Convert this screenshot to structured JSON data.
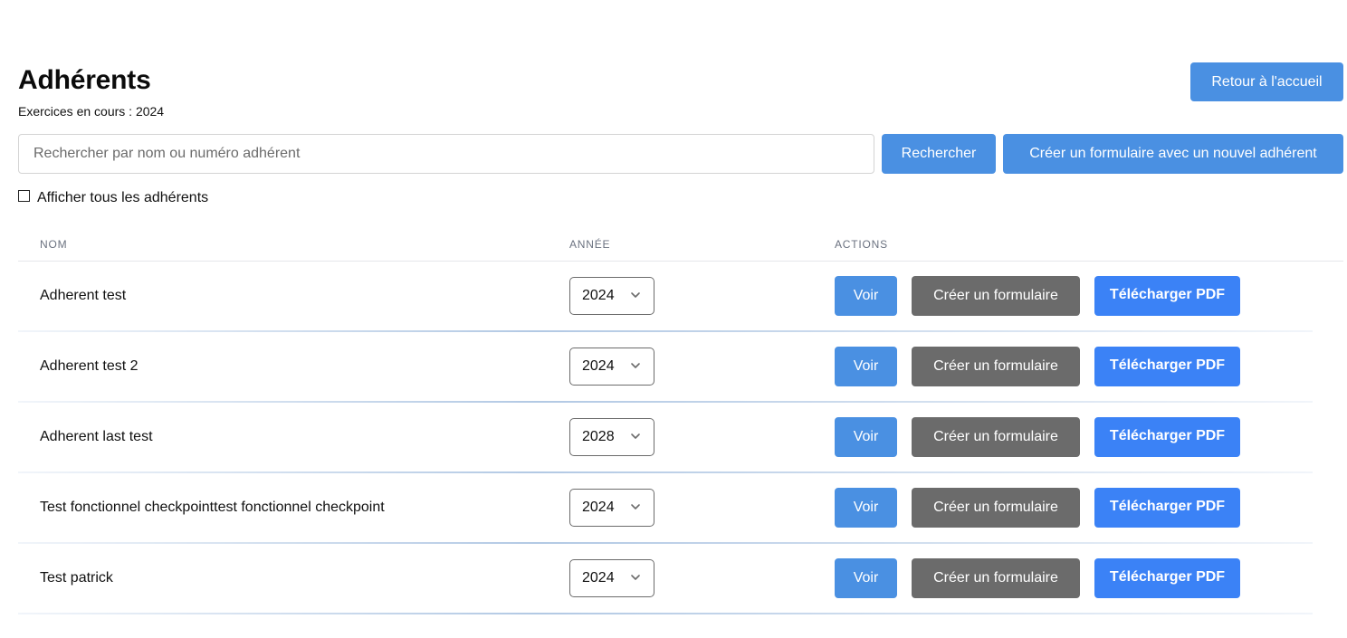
{
  "header": {
    "title": "Adhérents",
    "subtitle": "Exercices en cours : 2024",
    "home_button": "Retour à l'accueil"
  },
  "search": {
    "placeholder": "Rechercher par nom ou numéro adhérent",
    "value": "",
    "button": "Rechercher",
    "create_new_button": "Créer un formulaire avec un nouvel adhérent"
  },
  "filter": {
    "show_all_label": "Afficher tous les adhérents",
    "show_all_checked": false
  },
  "table": {
    "columns": [
      "NOM",
      "ANNÉE",
      "ACTIONS"
    ],
    "actions": {
      "view": "Voir",
      "create_form": "Créer un formulaire",
      "download_pdf": "Télécharger PDF"
    },
    "rows": [
      {
        "name": "Adherent test",
        "year": "2024"
      },
      {
        "name": "Adherent test 2",
        "year": "2024"
      },
      {
        "name": "Adherent last test",
        "year": "2028"
      },
      {
        "name": "Test fonctionnel checkpointtest fonctionnel checkpoint",
        "year": "2024"
      },
      {
        "name": "Test patrick",
        "year": "2024"
      }
    ]
  },
  "colors": {
    "primary_blue": "#4a90e2",
    "pdf_blue": "#3b82f6",
    "form_gray": "#6b6b6b"
  }
}
